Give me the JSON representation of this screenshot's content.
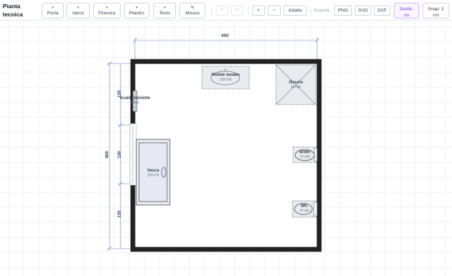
{
  "app": {
    "title": "Pianta tecnica"
  },
  "toolbar": {
    "tools": [
      {
        "icon": "+",
        "label": "Porta"
      },
      {
        "icon": "+",
        "label": "Varco"
      },
      {
        "icon": "+",
        "label": "Finestra"
      },
      {
        "icon": "+",
        "label": "Pilastro"
      },
      {
        "icon": "+",
        "label": "Testo"
      },
      {
        "icon": "✎",
        "label": "Misura"
      }
    ],
    "undo_icon": "↶",
    "redo_icon": "↷",
    "zoom_in_label": "+",
    "zoom_out_label": "−",
    "fit_label": "Adatta",
    "export_label": "Esporta",
    "export_png": "PNG",
    "export_svg": "SVG",
    "export_dxf": "DXF",
    "guides": "Guide: on",
    "snap": "Snap: 1 cm"
  },
  "dimensions": {
    "top_total": "400",
    "left_total": "400",
    "left_segments": [
      "135",
      "130",
      "135"
    ]
  },
  "fixtures": [
    {
      "name": "Mobile lavabo",
      "size": "105×50"
    },
    {
      "name": "Doccia",
      "size": "80×80"
    },
    {
      "name": "Scaldasalviette",
      "size": "50×6"
    },
    {
      "name": "Vasca",
      "size": "150×76"
    },
    {
      "name": "Bidet",
      "size": "37×55"
    },
    {
      "name": "WC",
      "size": "37×55"
    }
  ],
  "colors": {
    "wall": "#222222",
    "dimension_line": "#5b7fc4",
    "fixture_stroke": "#6b7280",
    "guides_accent": "#7c3aed"
  }
}
